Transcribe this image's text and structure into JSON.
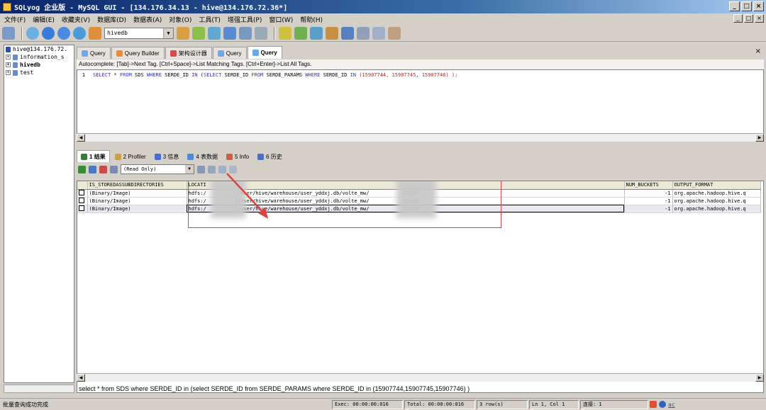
{
  "window": {
    "title": "SQLyog 企业版 - MySQL GUI - [134.176.34.13 - hive@134.176.72.36*]",
    "minimize": "_",
    "maximize": "□",
    "close": "×"
  },
  "menu": [
    "文件(F)",
    "编辑(E)",
    "收藏夹(V)",
    "数据库(D)",
    "数据表(A)",
    "对象(O)",
    "工具(T)",
    "增强工具(P)",
    "窗口(W)",
    "帮助(H)"
  ],
  "toolbar": {
    "database_select": "hivedb"
  },
  "sidebar": {
    "items": [
      {
        "label": "hive@134.176.72.",
        "toggle": ""
      },
      {
        "label": "information_s",
        "toggle": "+"
      },
      {
        "label": "hivedb",
        "toggle": "+"
      },
      {
        "label": "test",
        "toggle": "+"
      }
    ]
  },
  "query_tabs": [
    {
      "label": "Query",
      "color": "#6aa8e8"
    },
    {
      "label": "Query Builder",
      "color": "#e88a3a"
    },
    {
      "label": "架构设计器",
      "color": "#d84a4a"
    },
    {
      "label": "Query",
      "color": "#6aa8e8"
    },
    {
      "label": "Query",
      "color": "#6aa8e8",
      "active": true
    }
  ],
  "close_tab": "×",
  "autocomplete": "Autocomplete: [Tab]->Next Tag. [Ctrl+Space]->List Matching Tags. [Ctrl+Enter]->List All Tags.",
  "editor": {
    "line_number": "1",
    "sql": {
      "p1": "SELECT",
      "p2": " * ",
      "p3": "FROM",
      "p4": " SDS ",
      "p5": "WHERE",
      "p6": " SERDE_ID ",
      "p7": "IN",
      "p8": " (",
      "p9": "SELECT",
      "p10": " SERDE_ID ",
      "p11": "FROM",
      "p12": " SERDE_PARAMS ",
      "p13": "WHERE",
      "p14": " SERDE_ID ",
      "p15": "IN",
      "p16": " (15907744, 15907745, 15907746) );"
    }
  },
  "result_tabs": [
    {
      "label": "1 结果",
      "color": "#3a7a3a",
      "active": true
    },
    {
      "label": "2 Profiler",
      "color": "#c8a040"
    },
    {
      "label": "3 信息",
      "color": "#4a6ad8"
    },
    {
      "label": "4 表数据",
      "color": "#4a8ad8"
    },
    {
      "label": "5 Info",
      "color": "#d85a3a"
    },
    {
      "label": "6 历史",
      "color": "#4a6ad8"
    }
  ],
  "result_toolbar": {
    "mode_select": "(Read Only)"
  },
  "grid": {
    "columns": [
      "IS_STOREDASSUBDIRECTORIES",
      "LOCATI",
      "NUM_BUCKETS",
      "OUTPUT_FORMAT"
    ],
    "rows": [
      {
        "is_stored": "(Binary/Image)",
        "location": "hdfs:/",
        "location_mid": "1/user/hive/warehouse/user_yddxj.db/volte_mw/",
        "location_end": "11300",
        "num_buckets": "-1",
        "output_format": "org.apache.hadoop.hive.q"
      },
      {
        "is_stored": "(Binary/Image)",
        "location": "hdfs:/",
        "location_mid": "1/user/hive/warehouse/user_yddxj.db/volte_mw/",
        "location_end": "11305",
        "num_buckets": "-1",
        "output_format": "org.apache.hadoop.hive.q"
      },
      {
        "is_stored": "(Binary/Image)",
        "location": "hdfs:/",
        "location_mid": "1/user/hive/warehouse/user_yddxj.db/volte_mw/",
        "location_end": "11310",
        "num_buckets": "-1",
        "output_format": "org.apache.hadoop.hive.q"
      }
    ]
  },
  "sql_status": "select * from SDS where SERDE_ID in (select SERDE_ID from SERDE_PARAMS where SERDE_ID in (15907744,15907745,15907746) )",
  "statusbar": {
    "message": "批量查询成功完成",
    "exec": "Exec: 00:00:00:016",
    "total": "Total: 00:00:00:016",
    "rows": "3 row(s)",
    "position": "Ln 1, Col 1",
    "connections": "连接: 1",
    "extra": "ac"
  },
  "colors": {
    "annotation_red": "#e04040"
  }
}
